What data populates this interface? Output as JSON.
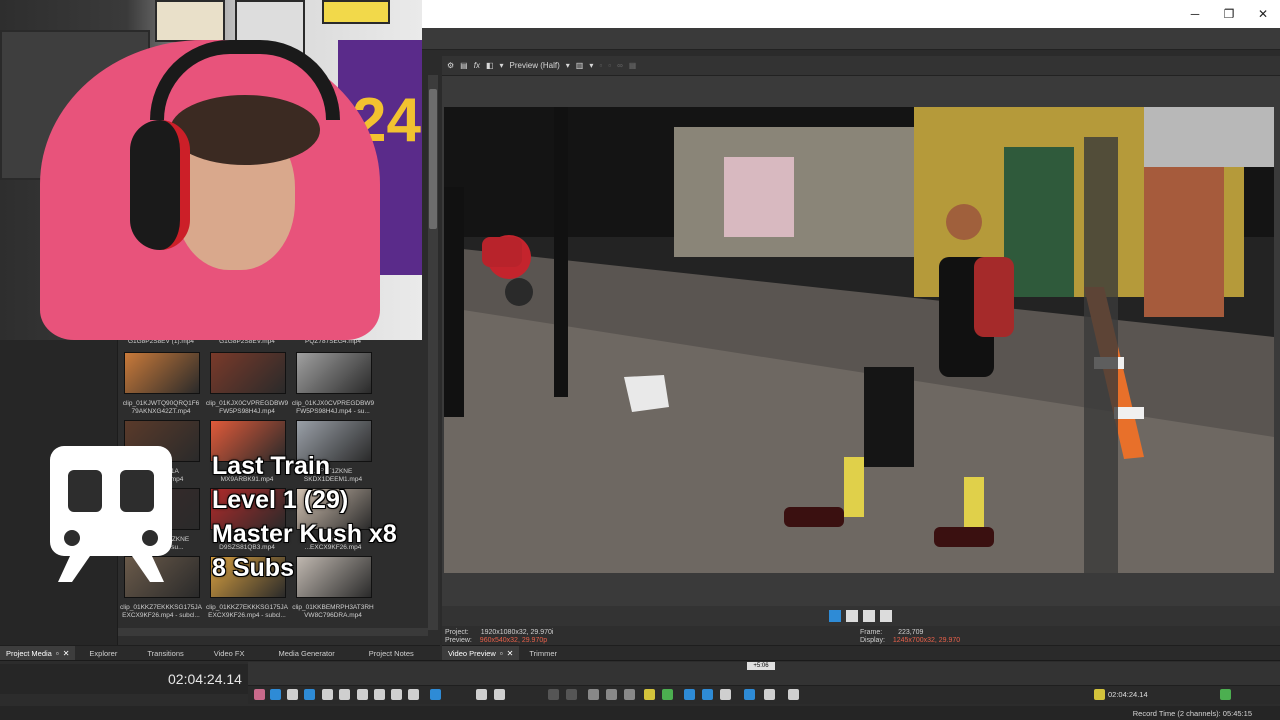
{
  "window": {
    "controls": {
      "minimize": "─",
      "restore": "❐",
      "close": "✕"
    }
  },
  "colors": {
    "accent_blue": "#2e8bd6",
    "preview_value_red": "#e8604a",
    "hoodie_pink": "#e8537b",
    "jersey_gold": "#f2c230"
  },
  "webcam": {
    "jersey_number": "24"
  },
  "project_media": {
    "rows": [
      {
        "labels": [
          "G1G8P2S8EV (1).mp4",
          "G1G8P2S8EV.mp4",
          "PQZ787SEG4.mp4"
        ]
      },
      {
        "labels": [
          "clip_01KJWTQ90QRQ1F6\n79AKNXG42ZT.mp4",
          "clip_01KJX0CVPREGDBW9\nFW5PS98H4J.mp4",
          "clip_01KJX0CVPREGDBW9\nFW5PS98H4J.mp4 - su..."
        ]
      },
      {
        "labels": [
          "...9XC1W1A\nXEKSX...T.mp4",
          "...KF5...\nMX9ARBK91.mp4",
          "...FVT1ZKNE\nSKDX1DEEM1.mp4"
        ]
      },
      {
        "labels": [
          "...1KK...FVT1ZKNE\n...DE...p4 - su...",
          "...\nD9SZS81QB3.mp4",
          "...01...\n...EXCX9KF26.mp4"
        ]
      },
      {
        "labels": [
          "clip_01KKZ7EKKKSG175JA\nEXCX9KF26.mp4 - subcl...",
          "clip_01KKZ7EKKKSG175JA\nEXCX9KF26.mp4 - subcl...",
          "clip_01KKBEMRPH3AT3RH\nVW8C796DRA.mp4"
        ]
      }
    ]
  },
  "overlay": {
    "line1": "Last Train",
    "line2": "Level 1 (29)",
    "line3": "Master Kush x8",
    "line4": "8 Subs"
  },
  "left_tabs": {
    "project_media": "Project Media",
    "explorer": "Explorer",
    "transitions": "Transitions",
    "video_fx": "Video FX",
    "media_generator": "Media Generator",
    "project_notes": "Project Notes"
  },
  "preview_toolbar": {
    "quality": "Preview (Half)"
  },
  "preview_info": {
    "project_label": "Project:",
    "project_value": "1920x1080x32, 29.970i",
    "preview_label": "Preview:",
    "preview_value": "960x540x32, 29.970p",
    "frame_label": "Frame:",
    "frame_value": "223,709",
    "display_label": "Display:",
    "display_value": "1245x700x32, 29.970"
  },
  "right_tabs": {
    "video_preview": "Video Preview",
    "trimmer": "Trimmer"
  },
  "timeline": {
    "timecode": "02:04:24.14",
    "marker": "+5:06",
    "cursor_timecode": "02:04:24.14",
    "record_time": "Record Time (2 channels): 05:45:15"
  }
}
